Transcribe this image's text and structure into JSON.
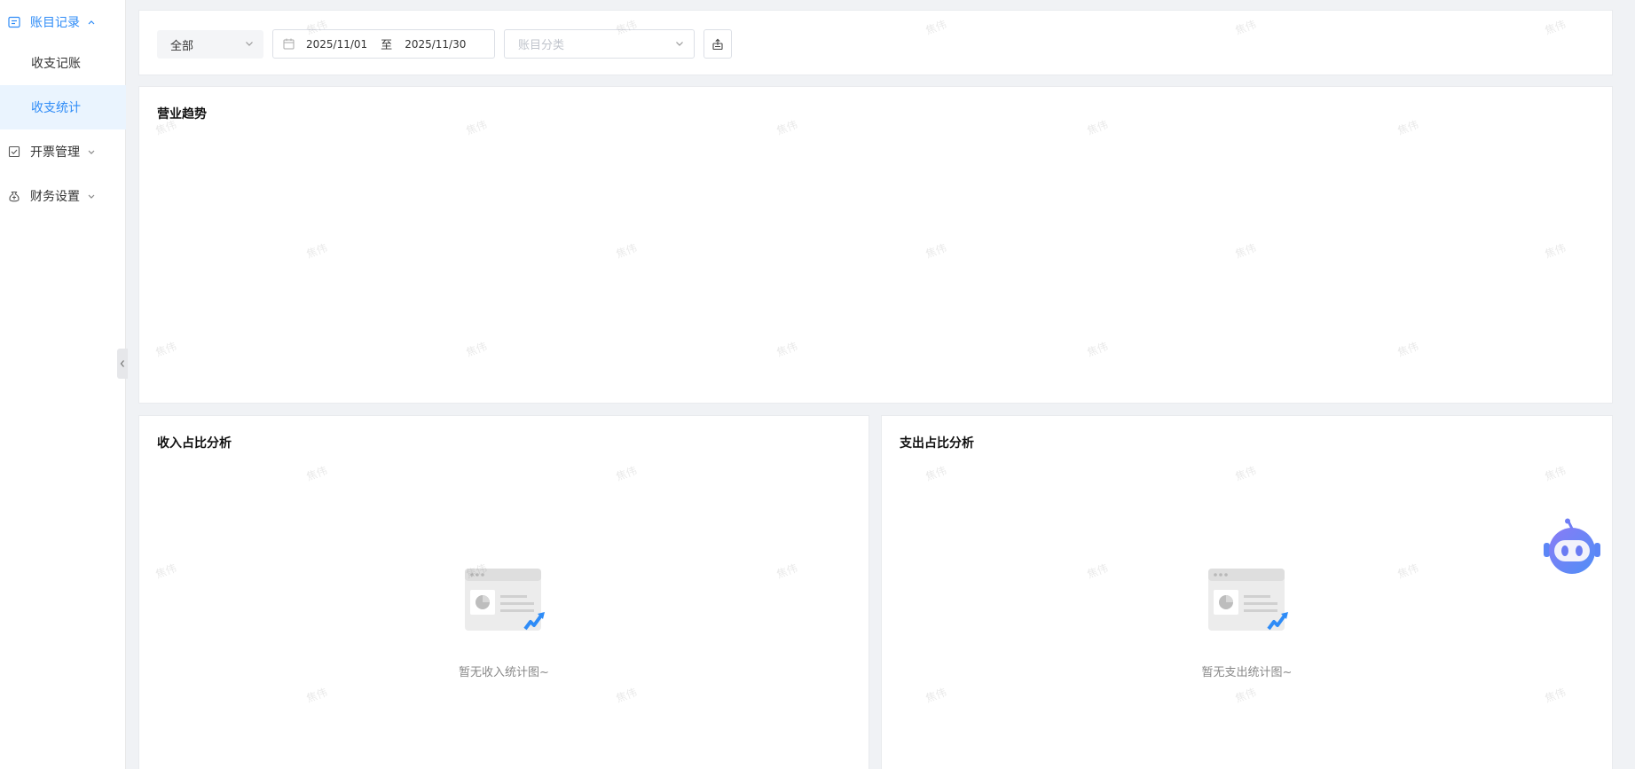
{
  "sidebar": {
    "items": [
      {
        "label": "账目记录",
        "icon": "ledger-icon",
        "expanded": true
      },
      {
        "label": "收支记账"
      },
      {
        "label": "收支统计",
        "active": true
      },
      {
        "label": "开票管理",
        "icon": "checkbox-icon",
        "expanded": false
      },
      {
        "label": "财务设置",
        "icon": "moneybag-icon",
        "expanded": false
      }
    ]
  },
  "filters": {
    "type_select": "全部",
    "date_start": "2025/11/01",
    "date_separator": "至",
    "date_end": "2025/11/30",
    "category_placeholder": "账目分类",
    "export_icon": "export-icon"
  },
  "trend": {
    "title": "营业趋势"
  },
  "income": {
    "title": "收入占比分析",
    "empty_text": "暂无收入统计图~"
  },
  "expense": {
    "title": "支出占比分析",
    "empty_text": "暂无支出统计图~"
  },
  "watermark": "焦伟",
  "colors": {
    "accent": "#2f8cf7",
    "active_bg": "#eaf4fe",
    "robot": "#6c7cf5"
  }
}
